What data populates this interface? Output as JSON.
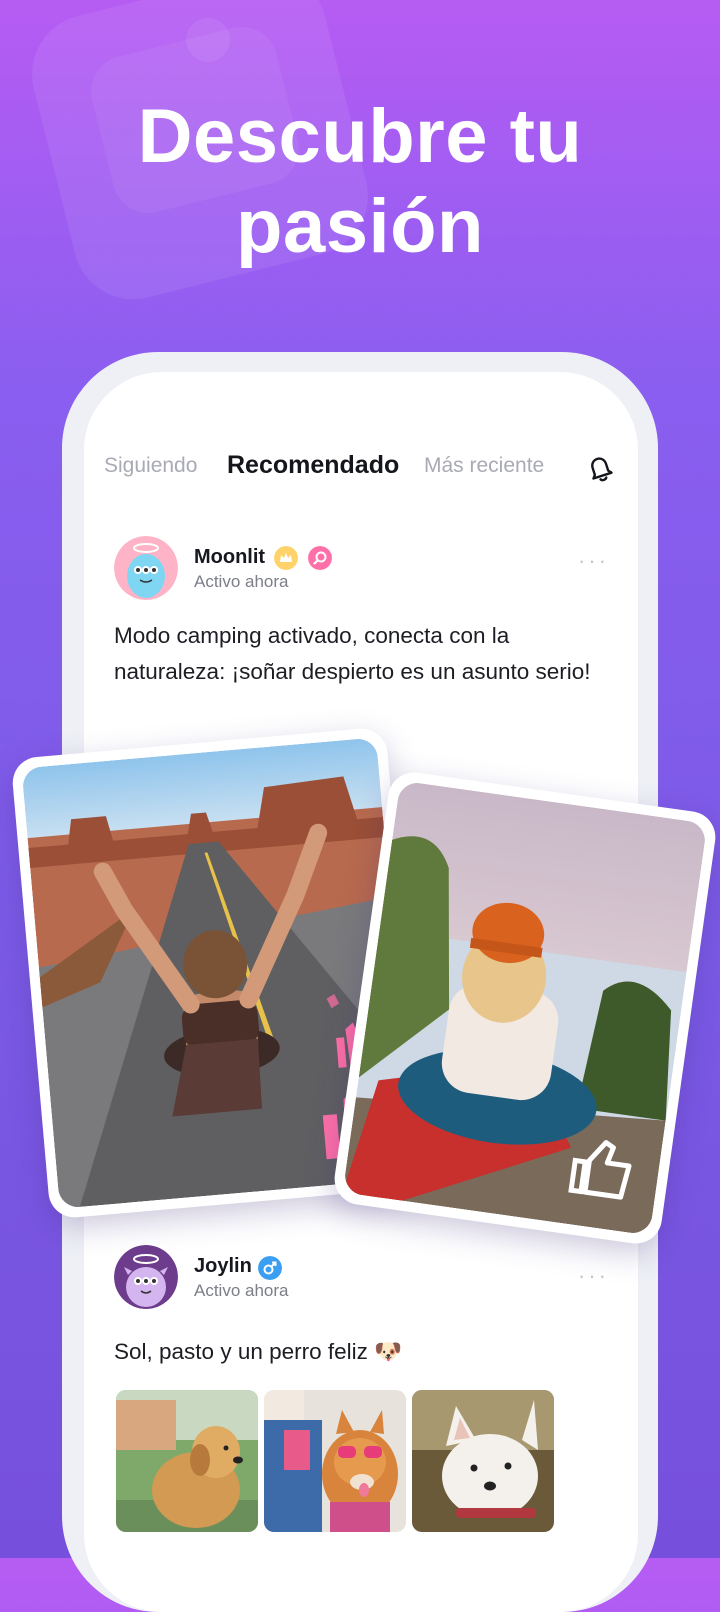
{
  "headline": {
    "line1": "Descubre tu",
    "line2": "pasión"
  },
  "tabs": {
    "following": "Siguiendo",
    "recommended": "Recomendado",
    "latest": "Más reciente"
  },
  "posts": [
    {
      "username": "Moonlit",
      "status": "Activo ahora",
      "text": "Modo camping activado, conecta con la naturaleza: ¡soñar despierto es un asunto serio!",
      "more": "···"
    },
    {
      "username": "Joylin",
      "status": "Activo ahora",
      "text": "Sol, pasto y un perro feliz 🐶",
      "more": "···"
    }
  ],
  "icons": {
    "bell": "bell-icon",
    "crown_badge": "crown-badge-icon",
    "search_badge": "search-badge-icon",
    "male_badge": "male-gender-icon",
    "thumbs_up": "thumbs-up-icon"
  },
  "colors": {
    "bg_top": "#b65cf3",
    "bg_bottom": "#7650dc",
    "like_pink": "#ff6fa8",
    "crown_yellow": "#ffd36a",
    "male_blue": "#3a9ef2"
  }
}
